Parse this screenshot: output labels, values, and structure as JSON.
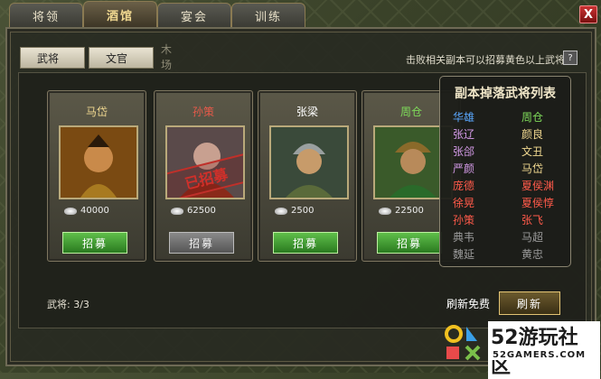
{
  "tabs": [
    {
      "label": "将领"
    },
    {
      "label": "酒馆"
    },
    {
      "label": "宴会"
    },
    {
      "label": "训练"
    }
  ],
  "close_label": "X",
  "subtabs": [
    {
      "label": "武将"
    },
    {
      "label": "文官"
    },
    {
      "label": "木场"
    }
  ],
  "hint": "击败相关副本可以招募黄色以上武将",
  "help_label": "?",
  "cards": [
    {
      "name": "马岱",
      "cost": "40000",
      "button": "招募",
      "name_color": "#f0d890"
    },
    {
      "name": "孙策",
      "cost": "62500",
      "button": "招募",
      "name_color": "#e85a4a",
      "stamp": "已招募"
    },
    {
      "name": "张梁",
      "cost": "2500",
      "button": "招募",
      "name_color": "#ffffff"
    },
    {
      "name": "周仓",
      "cost": "22500",
      "button": "招募",
      "name_color": "#7fdc5a"
    }
  ],
  "drop_list": {
    "title": "副本掉落武将列表",
    "left": [
      {
        "name": "华雄",
        "color": "#5aa8ff"
      },
      {
        "name": "张辽",
        "color": "#d59be8"
      },
      {
        "name": "张郃",
        "color": "#d59be8"
      },
      {
        "name": "严颜",
        "color": "#d59be8"
      },
      {
        "name": "庞德",
        "color": "#ff5a4a"
      },
      {
        "name": "徐晃",
        "color": "#ff5a4a"
      },
      {
        "name": "孙策",
        "color": "#ff5a4a"
      },
      {
        "name": "典韦",
        "color": "#9a9a9a"
      },
      {
        "name": "魏延",
        "color": "#9a9a9a"
      }
    ],
    "right": [
      {
        "name": "周仓",
        "color": "#7fdc5a"
      },
      {
        "name": "颜良",
        "color": "#f0d890"
      },
      {
        "name": "文丑",
        "color": "#f0d890"
      },
      {
        "name": "马岱",
        "color": "#f0d890"
      },
      {
        "name": "夏侯渊",
        "color": "#ff5a4a"
      },
      {
        "name": "夏侯惇",
        "color": "#ff5a4a"
      },
      {
        "name": "张飞",
        "color": "#ff5a4a"
      },
      {
        "name": "马超",
        "color": "#9a9a9a"
      },
      {
        "name": "黄忠",
        "color": "#9a9a9a"
      }
    ]
  },
  "footer": {
    "count": "武将: 3/3",
    "free": "刷新免费",
    "refresh": "刷新"
  },
  "watermark": {
    "text": "52游玩社区",
    "sub": "52GAMERS.COM"
  }
}
